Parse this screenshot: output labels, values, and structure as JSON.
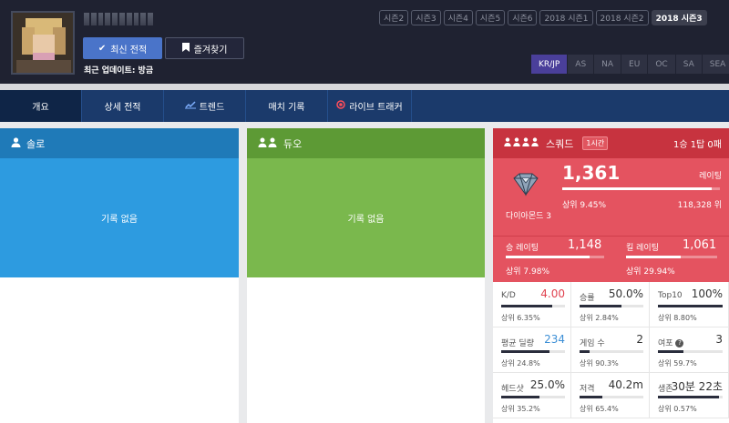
{
  "profile": {
    "recent_button": "최신 전적",
    "favorite_button": "즐겨찾기",
    "updated": "최근 업데이트: 방금"
  },
  "seasons": [
    "시즌2",
    "시즌3",
    "시즌4",
    "시즌5",
    "시즌6",
    "2018 시즌1",
    "2018 시즌2",
    "2018 시즌3"
  ],
  "active_season": "2018 시즌3",
  "regions": [
    "KR/JP",
    "AS",
    "NA",
    "EU",
    "OC",
    "SA",
    "SEA"
  ],
  "active_region": "KR/JP",
  "nav": {
    "tabs": [
      "개요",
      "상세 전적",
      "트렌드",
      "매치 기록",
      "라이브 트래커"
    ]
  },
  "solo": {
    "title": "솔로",
    "empty": "기록 없음"
  },
  "duo": {
    "title": "듀오",
    "empty": "기록 없음"
  },
  "squad": {
    "title": "스쿼드",
    "badge": "1시간",
    "record": "1승 1탑 0패",
    "tier": "다이아몬드 3",
    "rating": "1,361",
    "rating_label": "레이팅",
    "rating_top": "상위 9.45%",
    "rating_rank": "118,328 위",
    "rating_progress": 0.95,
    "win_rating_label": "승 레이팅",
    "win_rating": "1,148",
    "win_rating_top": "상위 7.98%",
    "win_rating_progress": 0.85,
    "kill_rating_label": "킬 레이팅",
    "kill_rating": "1,061",
    "kill_rating_top": "상위 29.94%",
    "kill_rating_progress": 0.6,
    "stats": [
      {
        "label": "K/D",
        "value": "4.00",
        "top": "상위 6.35%",
        "progress": 0.8,
        "color": "red"
      },
      {
        "label": "승률",
        "value": "50.0%",
        "top": "상위 2.84%",
        "progress": 0.65,
        "color": ""
      },
      {
        "label": "Top10",
        "value": "100%",
        "top": "상위 8.80%",
        "progress": 1.0,
        "color": ""
      },
      {
        "label": "평균 딜량",
        "value": "234",
        "top": "상위 24.8%",
        "progress": 0.75,
        "color": "blue"
      },
      {
        "label": "게임 수",
        "value": "2",
        "top": "상위 90.3%",
        "progress": 0.15,
        "color": ""
      },
      {
        "label": "여포",
        "value": "3",
        "top": "상위 59.7%",
        "progress": 0.4,
        "color": ""
      },
      {
        "label": "헤드샷",
        "value": "25.0%",
        "top": "상위 35.2%",
        "progress": 0.6,
        "color": ""
      },
      {
        "label": "저격",
        "value": "40.2m",
        "top": "상위 65.4%",
        "progress": 0.35,
        "color": ""
      },
      {
        "label": "생존",
        "value": "30분 22초",
        "top": "상위 0.57%",
        "progress": 0.95,
        "color": ""
      }
    ]
  }
}
